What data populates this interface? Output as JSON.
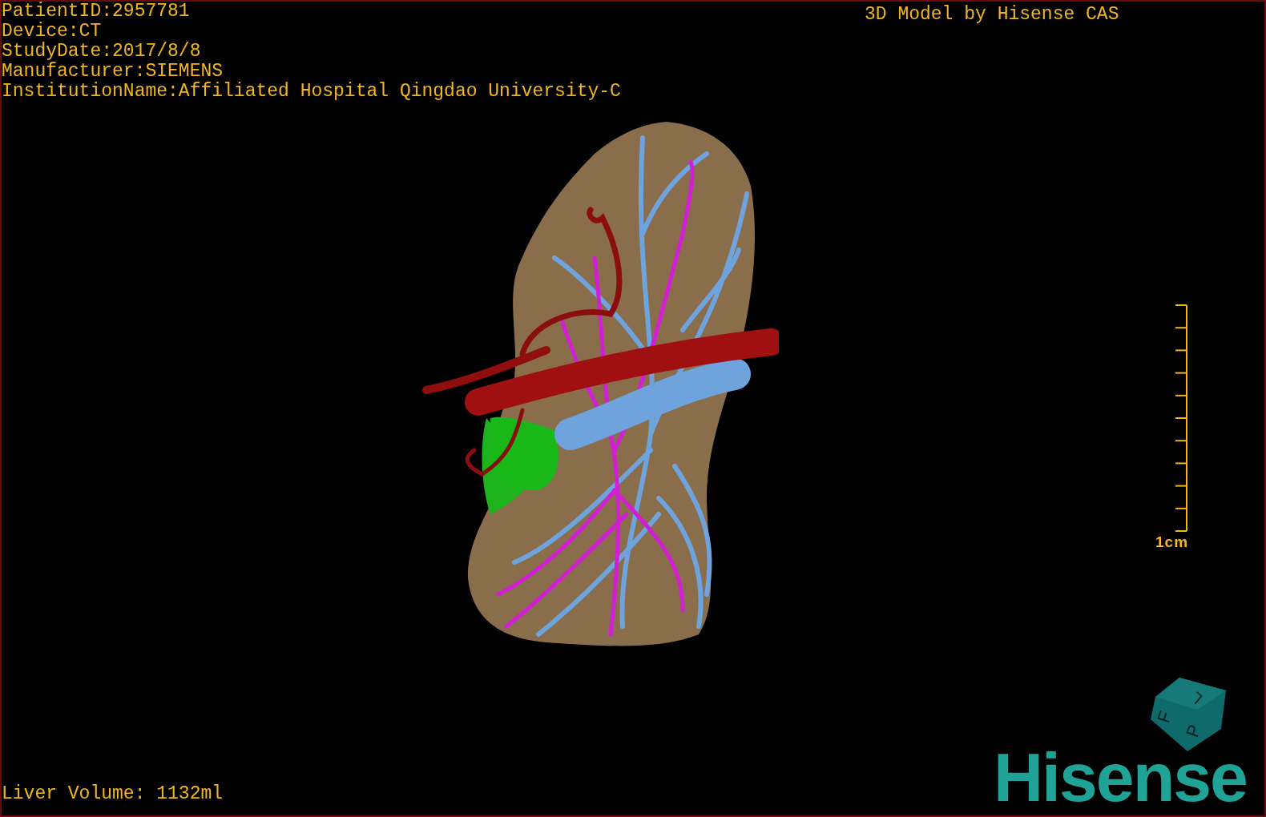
{
  "patient_info": [
    "PatientID:2957781",
    "Device:CT",
    "StudyDate:2017/8/8",
    "Manufacturer:SIEMENS",
    "InstitutionName:Affiliated Hospital Qingdao University-C"
  ],
  "title": "3D Model by Hisense CAS",
  "scale_bar": {
    "label": "1cm"
  },
  "liver_volume": "Liver Volume: 1132ml",
  "orientation_cube": {
    "faces": [
      "F",
      "L",
      "P"
    ]
  },
  "logo": "Hisense"
}
